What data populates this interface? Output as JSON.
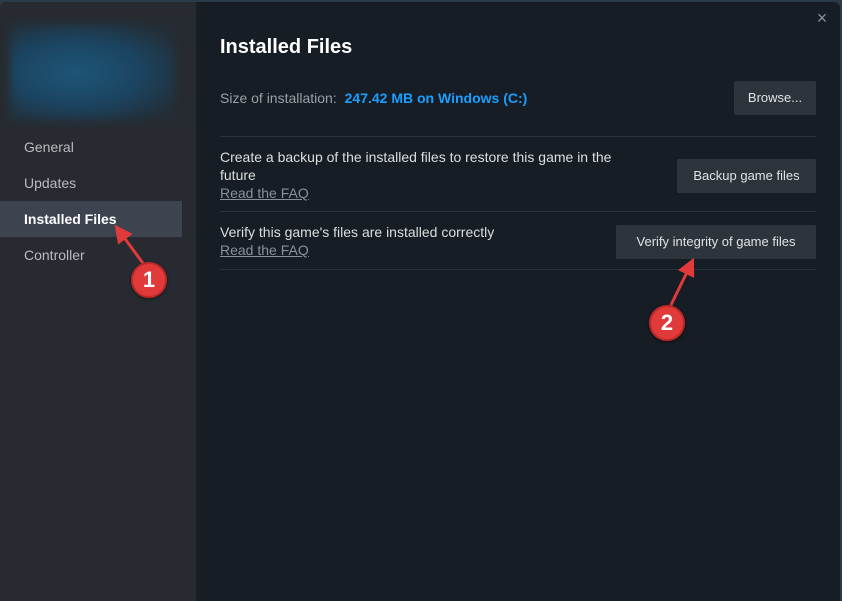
{
  "sidebar": {
    "items": [
      {
        "label": "General",
        "active": false
      },
      {
        "label": "Updates",
        "active": false
      },
      {
        "label": "Installed Files",
        "active": true
      },
      {
        "label": "Controller",
        "active": false
      }
    ]
  },
  "main": {
    "title": "Installed Files",
    "close_icon": "×",
    "size_label": "Size of installation:",
    "size_value": "247.42 MB on Windows (C:)",
    "browse_label": "Browse...",
    "backup": {
      "description": "Create a backup of the installed files to restore this game in the future",
      "faq_link": "Read the FAQ",
      "button_label": "Backup game files"
    },
    "verify": {
      "description": "Verify this game's files are installed correctly",
      "faq_link": "Read the FAQ",
      "button_label": "Verify integrity of game files"
    }
  },
  "annotations": [
    {
      "number": "1",
      "target": "Installed Files"
    },
    {
      "number": "2",
      "target": "Verify integrity of game files"
    }
  ],
  "colors": {
    "accent": "#1a9fff",
    "annotation": "#e03a3a"
  }
}
